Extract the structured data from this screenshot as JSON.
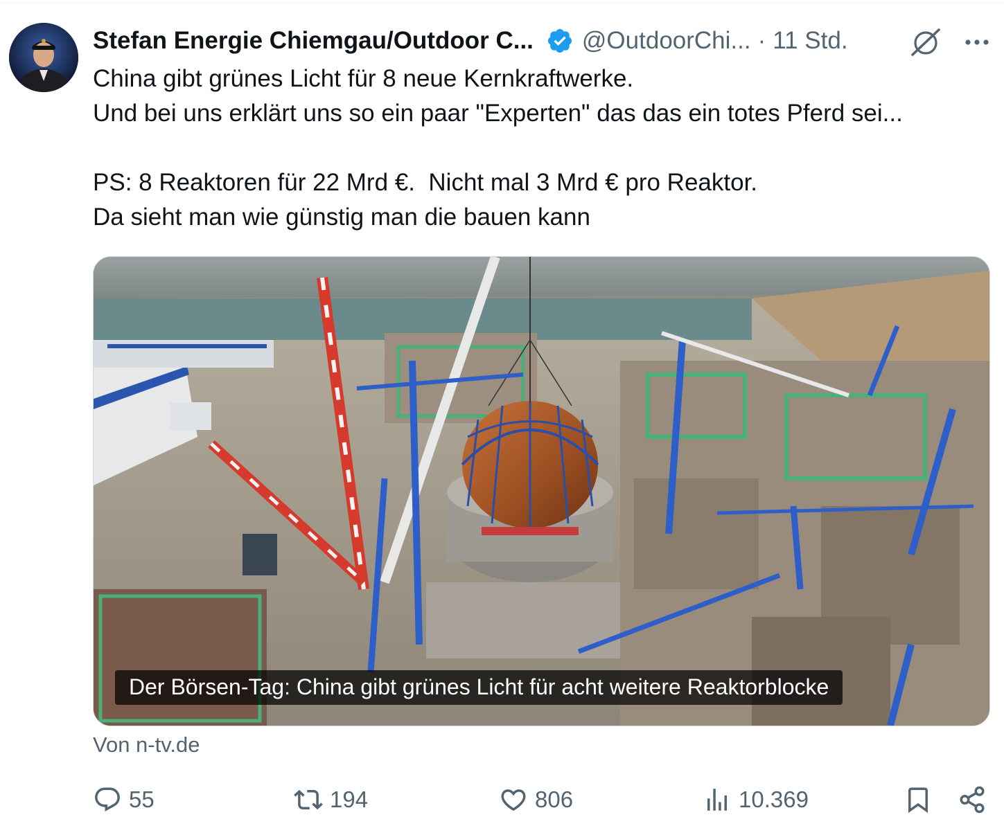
{
  "tweet": {
    "author": {
      "display_name": "Stefan Energie Chiemgau/Outdoor C...",
      "handle": "@OutdoorChi...",
      "verified": true,
      "avatar_icon": "profile-photo"
    },
    "separator": "·",
    "time": "11 Std.",
    "text_lines": [
      "China gibt grünes Licht für 8 neue Kernkraftwerke.",
      "Und bei uns erklärt uns so ein paar \"Experten\" das das ein totes Pferd sei...",
      "",
      "PS: 8 Reaktoren für 22 Mrd €.  Nicht mal 3 Mrd € pro Reaktor.",
      "Da sieht man wie günstig man die bauen kann"
    ],
    "media": {
      "caption": "Der Börsen-Tag: China gibt grünes Licht für acht weitere Reaktorblocke",
      "source": "Von n-tv.de"
    },
    "actions": {
      "replies": "55",
      "reposts": "194",
      "likes": "806",
      "views": "10.369"
    }
  },
  "icons": {
    "verified": "verified-badge-icon",
    "grok": "grok-icon",
    "more": "more-icon",
    "reply": "reply-icon",
    "repost": "repost-icon",
    "like": "like-icon",
    "views": "views-icon",
    "bookmark": "bookmark-icon",
    "share": "share-icon"
  },
  "colors": {
    "text_primary": "#0f1419",
    "text_secondary": "#536471",
    "verified_blue": "#1d9bf0"
  }
}
